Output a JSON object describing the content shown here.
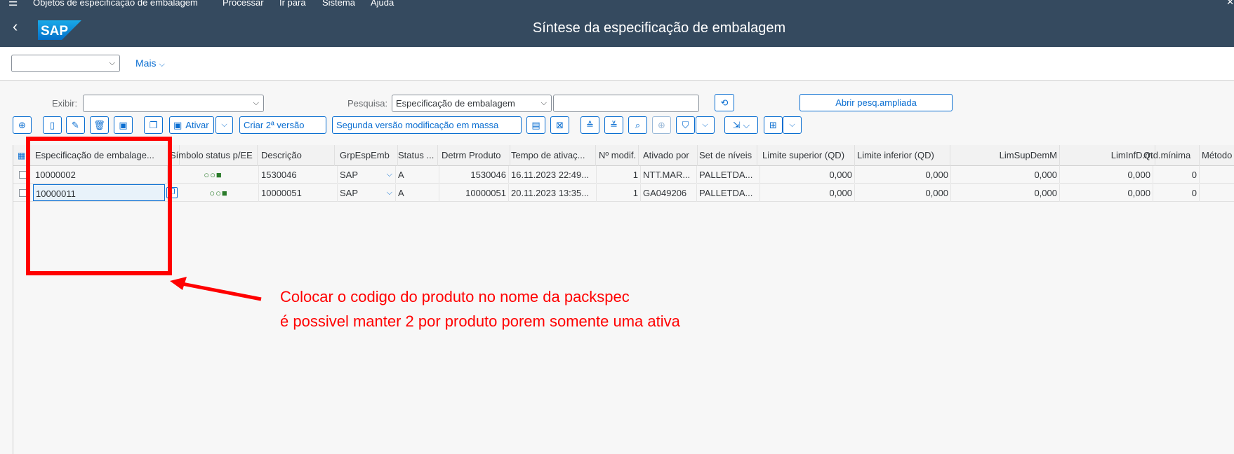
{
  "menu": {
    "items": [
      "Objetos de especificação de embalagem",
      "Processar",
      "Ir para",
      "Sistema",
      "Ajuda"
    ]
  },
  "shell": {
    "back_icon": "chevron-left-icon",
    "logo": "SAP",
    "title": "Síntese da especificação de embalagem"
  },
  "variant": {
    "value": "",
    "more_label": "Mais"
  },
  "search": {
    "exibir_label": "Exibir:",
    "exibir_value": "",
    "pesquisa_label": "Pesquisa:",
    "pesquisa_value": "Especificação de embalagem",
    "search_text": "",
    "advanced_button": "Abrir pesq.ampliada"
  },
  "toolbar": {
    "ativar": "Ativar",
    "criar": "Criar 2ª versão",
    "segunda": "Segunda versão modificação em massa"
  },
  "table": {
    "columns": [
      "Especificação de embalage...",
      "Símbolo status p/EE",
      "Descrição",
      "GrpEspEmb",
      "Status ...",
      "Detrm Produto",
      "Tempo de ativaç...",
      "Nº modif.",
      "Ativado por",
      "Set de níveis",
      "Limite superior (QD)",
      "Limite inferior (QD)",
      "LimSupDemM",
      "LimInfD.m",
      "Qtd.mínima",
      "Método"
    ],
    "rows": [
      {
        "spec": "10000002",
        "status_symbol": "○○■",
        "descricao": "1530046",
        "grp": "SAP",
        "status": "A",
        "detrm": "1530046",
        "tempo": "16.11.2023 22:49...",
        "modif": "1",
        "ativado": "NTT.MAR...",
        "set": "PALLETDA...",
        "lim_sup": "0,000",
        "lim_inf": "0,000",
        "limsupdem": "0,000",
        "liminfd": "0,000",
        "qtd": "0"
      },
      {
        "spec": "10000011",
        "status_symbol": "○○■",
        "descricao": "10000051",
        "grp": "SAP",
        "status": "A",
        "detrm": "10000051",
        "tempo": "20.11.2023 13:35...",
        "modif": "1",
        "ativado": "GA049206",
        "set": "PALLETDA...",
        "lim_sup": "0,000",
        "lim_inf": "0,000",
        "limsupdem": "0,000",
        "liminfd": "0,000",
        "qtd": "0"
      }
    ]
  },
  "annotation": {
    "line1": "Colocar o codigo do produto no nome da packspec",
    "line2": "é possivel manter 2 por produto porem somente uma ativa",
    "color": "#ff0000"
  },
  "colors": {
    "shell": "#354a5f",
    "accent": "#0a6ed1"
  }
}
